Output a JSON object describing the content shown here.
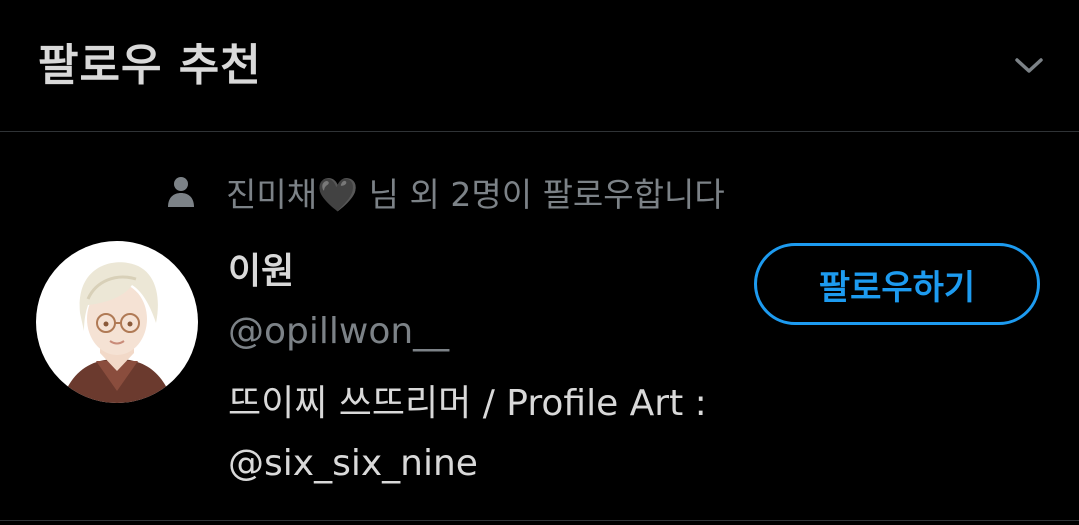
{
  "header": {
    "title": "팔로우 추천",
    "collapse_icon": "chevron-down-icon"
  },
  "suggestion": {
    "social_context": "진미채🖤 님 외 2명이 팔로우합니다",
    "social_icon": "person-icon",
    "display_name": "이원",
    "handle": "@opillwon__",
    "bio_line1": "뜨이찌 쓰뜨리머 / Profile Art :",
    "bio_line2": "@six_six_nine",
    "follow_label": "팔로우하기"
  },
  "colors": {
    "background": "#000000",
    "primary_text": "#d9d9d9",
    "secondary_text": "#7c8287",
    "accent": "#1d9bf0",
    "divider": "#2f3336"
  }
}
